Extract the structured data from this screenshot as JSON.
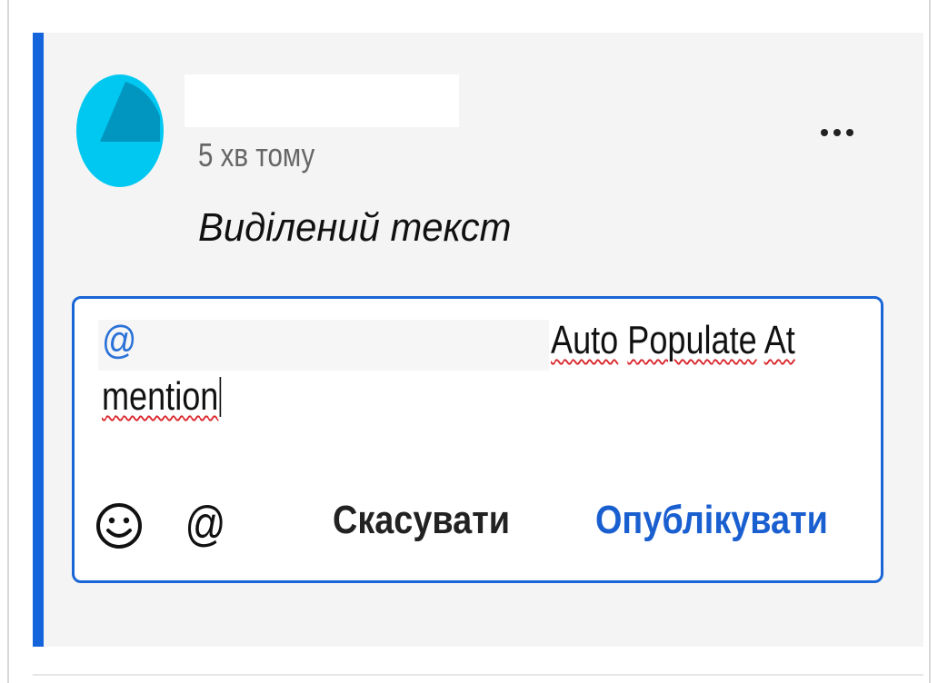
{
  "comment": {
    "timestamp": "5 хв тому",
    "selected_text": "Виділений текст",
    "more_icon": "ellipsis-horizontal-icon"
  },
  "editor": {
    "mention_prefix": "@",
    "text_line1_words": [
      "Auto",
      "Populate",
      "At"
    ],
    "text_line2": "mention"
  },
  "toolbar": {
    "emoji_icon": "smiley-icon",
    "mention_label": "@",
    "cancel_label": "Скасувати",
    "publish_label": "Опублікувати"
  },
  "colors": {
    "accent": "#1464dc",
    "avatar_light": "#00c8f0",
    "avatar_dark": "#0096c0"
  }
}
